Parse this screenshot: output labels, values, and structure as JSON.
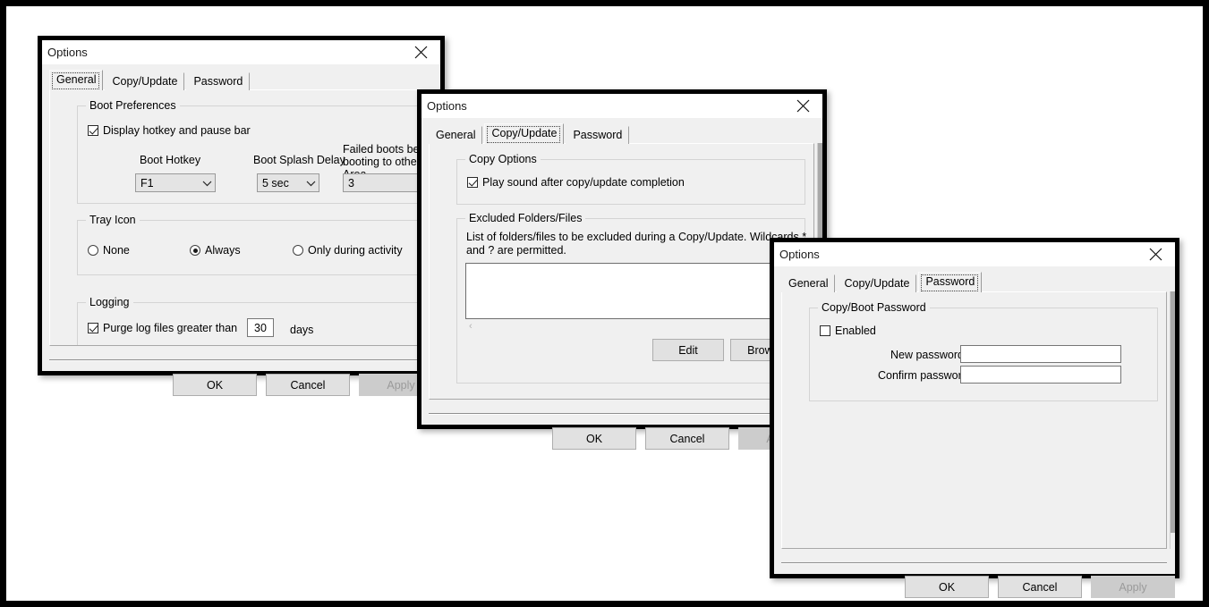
{
  "dialogs": [
    {
      "id": "general",
      "title": "Options",
      "tabs": [
        {
          "label": "General",
          "selected": true
        },
        {
          "label": "Copy/Update",
          "selected": false
        },
        {
          "label": "Password",
          "selected": false
        }
      ],
      "groups": {
        "boot_preferences": {
          "title": "Boot Preferences",
          "display_hotkey_checkbox": {
            "label": "Display hotkey and pause bar",
            "checked": true
          },
          "boot_hotkey": {
            "label": "Boot Hotkey",
            "value": "F1"
          },
          "boot_splash_delay": {
            "label": "Boot Splash Delay",
            "value": "5 sec"
          },
          "failed_boots": {
            "label": "Failed boots before booting to other Area",
            "value": "3"
          }
        },
        "tray_icon": {
          "title": "Tray Icon",
          "options": [
            {
              "label": "None",
              "selected": false
            },
            {
              "label": "Always",
              "selected": true
            },
            {
              "label": "Only during activity",
              "selected": false
            }
          ]
        },
        "logging": {
          "title": "Logging",
          "purge_checkbox": {
            "label": "Purge log files greater than",
            "checked": true
          },
          "purge_days_value": "30",
          "days_suffix": "days"
        }
      },
      "buttons": {
        "ok": "OK",
        "cancel": "Cancel",
        "apply": "Apply"
      }
    },
    {
      "id": "copyupdate",
      "title": "Options",
      "tabs": [
        {
          "label": "General",
          "selected": false
        },
        {
          "label": "Copy/Update",
          "selected": true
        },
        {
          "label": "Password",
          "selected": false
        }
      ],
      "groups": {
        "copy_options": {
          "title": "Copy Options",
          "play_sound_checkbox": {
            "label": "Play sound after copy/update completion",
            "checked": true
          }
        },
        "excluded": {
          "title": "Excluded Folders/Files",
          "description": "List of folders/files to be excluded during a Copy/Update.  Wildcards * and ? are permitted.",
          "list_value": "",
          "edit_button": "Edit",
          "browse_button": "Browse"
        }
      },
      "buttons": {
        "ok": "OK",
        "cancel": "Cancel",
        "apply": "Apply"
      }
    },
    {
      "id": "password",
      "title": "Options",
      "tabs": [
        {
          "label": "General",
          "selected": false
        },
        {
          "label": "Copy/Update",
          "selected": false
        },
        {
          "label": "Password",
          "selected": true
        }
      ],
      "groups": {
        "copy_boot_password": {
          "title": "Copy/Boot Password",
          "enabled_checkbox": {
            "label": "Enabled",
            "checked": false
          },
          "new_password": {
            "label": "New password",
            "value": ""
          },
          "confirm_password": {
            "label": "Confirm password",
            "value": ""
          }
        }
      },
      "buttons": {
        "ok": "OK",
        "cancel": "Cancel",
        "apply": "Apply"
      }
    }
  ],
  "icons": {
    "close": "close-icon",
    "chevron_down": "chevron-down-icon"
  },
  "colors": {
    "dialog_background": "#f0f0f0",
    "titlebar_background": "#ffffff",
    "border": "#000000",
    "field_background": "#ffffff",
    "button_background": "#e1e1e1",
    "disabled_text": "#9a9a9a"
  }
}
